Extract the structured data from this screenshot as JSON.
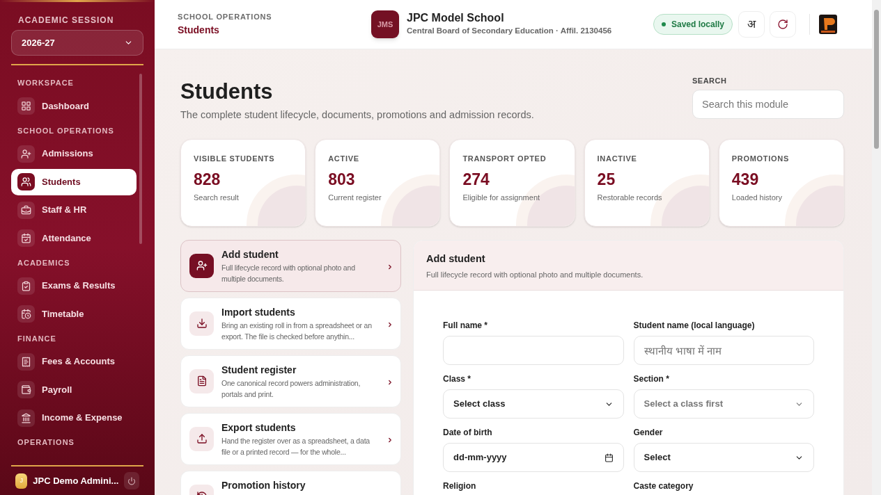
{
  "sidebar": {
    "session_label": "ACADEMIC SESSION",
    "session_value": "2026-27",
    "sections": [
      {
        "title": "WORKSPACE",
        "items": [
          {
            "label": "Dashboard",
            "selected": false
          }
        ]
      },
      {
        "title": "SCHOOL OPERATIONS",
        "items": [
          {
            "label": "Admissions",
            "selected": false
          },
          {
            "label": "Students",
            "selected": true
          },
          {
            "label": "Staff & HR",
            "selected": false
          },
          {
            "label": "Attendance",
            "selected": false
          }
        ]
      },
      {
        "title": "ACADEMICS",
        "items": [
          {
            "label": "Exams & Results",
            "selected": false
          },
          {
            "label": "Timetable",
            "selected": false
          }
        ]
      },
      {
        "title": "FINANCE",
        "items": [
          {
            "label": "Fees & Accounts",
            "selected": false
          },
          {
            "label": "Payroll",
            "selected": false
          },
          {
            "label": "Income & Expense",
            "selected": false
          }
        ]
      },
      {
        "title": "OPERATIONS"
      }
    ],
    "user": {
      "initial": "J",
      "name": "JPC Demo Admini..."
    }
  },
  "header": {
    "breadcrumb_parent": "SCHOOL OPERATIONS",
    "breadcrumb_current": "Students",
    "school_initials": "JMS",
    "school_name": "JPC Model School",
    "school_subtitle": "Central Board of Secondary Education · Affil. 2130456",
    "status": "Saved locally",
    "language_button": "अ"
  },
  "page": {
    "title": "Students",
    "subtitle": "The complete student lifecycle, documents, promotions and admission records.",
    "search_label": "SEARCH",
    "search_placeholder": "Search this module"
  },
  "stats": [
    {
      "label": "VISIBLE STUDENTS",
      "value": "828",
      "caption": "Search result"
    },
    {
      "label": "ACTIVE",
      "value": "803",
      "caption": "Current register"
    },
    {
      "label": "TRANSPORT OPTED",
      "value": "274",
      "caption": "Eligible for assignment"
    },
    {
      "label": "INACTIVE",
      "value": "25",
      "caption": "Restorable records"
    },
    {
      "label": "PROMOTIONS",
      "value": "439",
      "caption": "Loaded history"
    }
  ],
  "actions": [
    {
      "title": "Add student",
      "description": "Full lifecycle record with optional photo and multiple documents.",
      "selected": true
    },
    {
      "title": "Import students",
      "description": "Bring an existing roll in from a spreadsheet or an export. The file is checked before anythin...",
      "selected": false
    },
    {
      "title": "Student register",
      "description": "One canonical record powers administration, portals and print.",
      "selected": false
    },
    {
      "title": "Export students",
      "description": "Hand the register over as a spreadsheet, a data file or a printed record — for the whole...",
      "selected": false
    },
    {
      "title": "Promotion history",
      "selected": false
    }
  ],
  "form": {
    "title": "Add student",
    "subtitle": "Full lifecycle record with optional photo and multiple documents.",
    "fields": [
      {
        "label": "Full name *",
        "kind": "text"
      },
      {
        "label": "Student name (local language)",
        "kind": "text",
        "placeholder": "स्थानीय भाषा में नाम"
      },
      {
        "label": "Class *",
        "kind": "select",
        "value": "Select class",
        "disabled": false
      },
      {
        "label": "Section *",
        "kind": "select",
        "value": "Select a class first",
        "disabled": true
      },
      {
        "label": "Date of birth",
        "kind": "date",
        "value": "dd-mm-yyyy"
      },
      {
        "label": "Gender",
        "kind": "select",
        "value": "Select",
        "disabled": false
      },
      {
        "label": "Religion"
      },
      {
        "label": "Caste category"
      }
    ]
  }
}
